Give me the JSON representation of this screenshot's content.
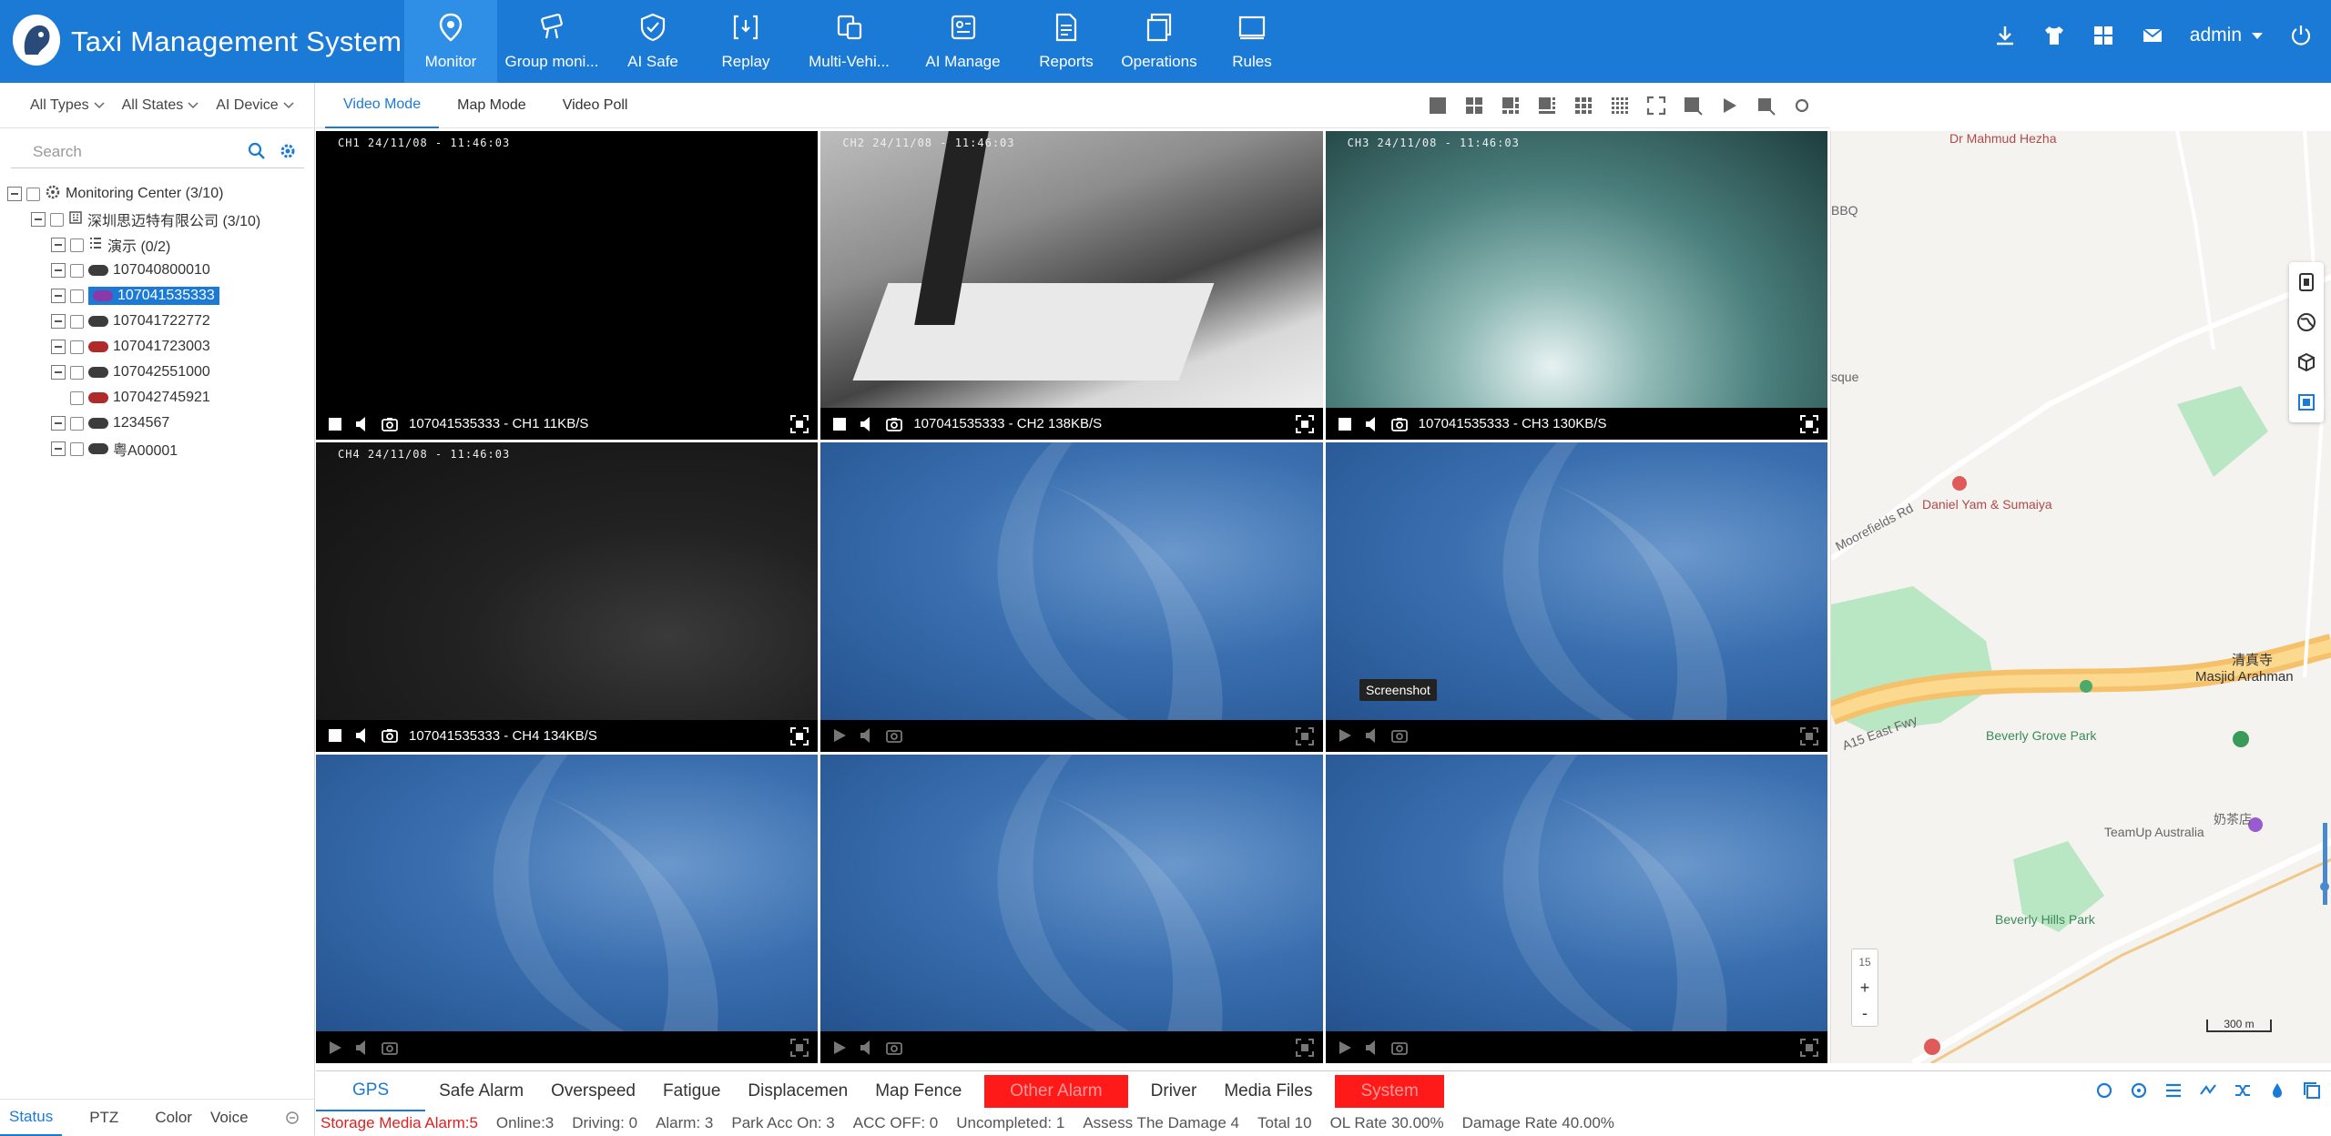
{
  "header": {
    "title": "Taxi Management System",
    "nav": [
      {
        "label": "Monitor",
        "icon": "location-pin-icon"
      },
      {
        "label": "Group moni...",
        "icon": "camera-icon"
      },
      {
        "label": "AI Safe",
        "icon": "shield-icon"
      },
      {
        "label": "Replay",
        "icon": "replay-icon"
      },
      {
        "label": "Multi-Vehi...",
        "icon": "multi-vehicle-icon"
      },
      {
        "label": "AI Manage",
        "icon": "ai-manage-icon"
      },
      {
        "label": "Reports",
        "icon": "report-icon"
      },
      {
        "label": "Operations",
        "icon": "operations-icon"
      },
      {
        "label": "Rules",
        "icon": "rules-icon"
      }
    ],
    "user": "admin",
    "colors": {
      "header_bg": "#1a7ad6",
      "active_nav": "#2f8fe6"
    }
  },
  "filters": {
    "types": "All Types",
    "states": "All States",
    "device": "AI Device"
  },
  "search": {
    "placeholder": "Search"
  },
  "tree": {
    "root": "Monitoring Center  (3/10)",
    "company": "深圳思迈特有限公司  (3/10)",
    "group": "演示  (0/2)",
    "vehicles": [
      "107040800010",
      "107041535333",
      "107041722772",
      "107041723003",
      "107042551000",
      "107042745921",
      "1234567",
      "粤A00001"
    ]
  },
  "left_tabs": [
    "Status",
    "PTZ",
    "Color",
    "Voice"
  ],
  "mode_tabs": [
    "Video Mode",
    "Map Mode",
    "Video Poll"
  ],
  "videos": [
    {
      "osd": "CH1 24/11/08 - 11:46:03",
      "label": "107041535333 - CH1 11KB/S"
    },
    {
      "osd": "CH2 24/11/08 - 11:46:03",
      "label": "107041535333 - CH2 138KB/S"
    },
    {
      "osd": "CH3 24/11/08 - 11:46:03",
      "label": "107041535333 - CH3 130KB/S"
    },
    {
      "osd": "CH4 24/11/08 - 11:46:03",
      "label": "107041535333 - CH4 134KB/S"
    }
  ],
  "tooltip": "Screenshot",
  "map": {
    "labels": {
      "hotel": "Dr Mahmud Hezha",
      "bbq": "BBQ",
      "mosque_left": "sque",
      "restaurant": "Daniel Yam & Sumaiya",
      "road1": "Moorefields Rd",
      "masjid_cn": "清真寺",
      "masjid": "Masjid Arahman",
      "freeway": "A15 East Fwy",
      "park1": "Beverly Grove Park",
      "shop_cn": "奶茶店",
      "shop": "TeamUp Australia",
      "park2": "Beverly Hills Park"
    },
    "zoom_level": "15",
    "zoom_in": "+",
    "zoom_out": "-",
    "scale": "300 m"
  },
  "bottom_tabs": [
    {
      "label": "GPS",
      "style": "active"
    },
    {
      "label": "Safe Alarm",
      "style": ""
    },
    {
      "label": "Overspeed",
      "style": ""
    },
    {
      "label": "Fatigue",
      "style": ""
    },
    {
      "label": "Displacemen",
      "style": ""
    },
    {
      "label": "Map Fence",
      "style": ""
    },
    {
      "label": "Other Alarm",
      "style": "red"
    },
    {
      "label": "Driver",
      "style": ""
    },
    {
      "label": "Media Files",
      "style": ""
    },
    {
      "label": "System",
      "style": "red"
    }
  ],
  "status": {
    "storage": "Storage Media Alarm:5",
    "online": "Online:3",
    "driving": "Driving: 0",
    "alarm": "Alarm: 3",
    "park": "Park Acc On: 3",
    "acc_off": "ACC OFF: 0",
    "uncompleted": "Uncompleted: 1",
    "assess": "Assess The Damage 4",
    "total": "Total 10",
    "ol_rate": "OL Rate 30.00%",
    "damage_rate": "Damage Rate 40.00%"
  }
}
